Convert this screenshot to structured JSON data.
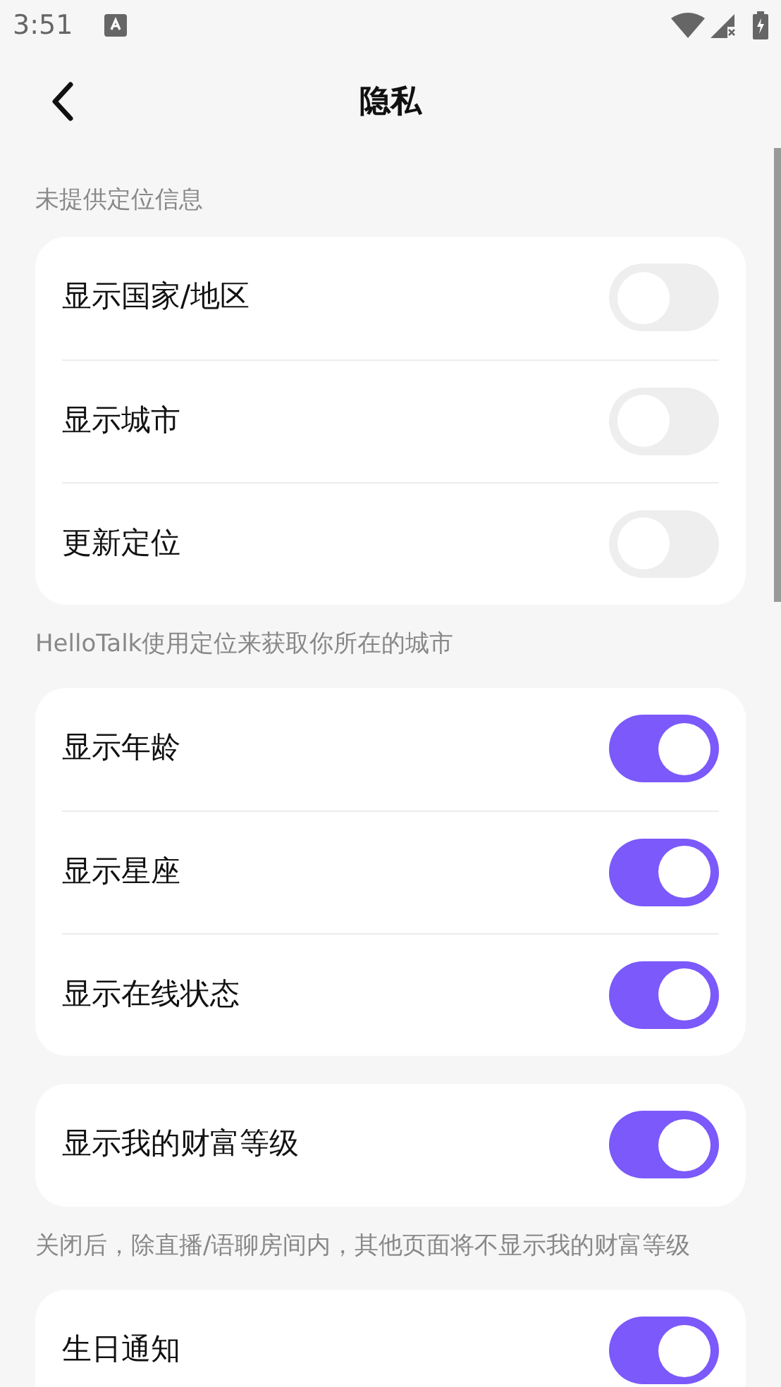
{
  "status_bar": {
    "time": "3:51"
  },
  "header": {
    "title": "隐私"
  },
  "groups": [
    {
      "header": "未提供定位信息",
      "rows": [
        {
          "label": "显示国家/地区",
          "on": false
        },
        {
          "label": "显示城市",
          "on": false
        },
        {
          "label": "更新定位",
          "on": false
        }
      ],
      "footer": "HelloTalk使用定位来获取你所在的城市"
    },
    {
      "rows": [
        {
          "label": "显示年龄",
          "on": true
        },
        {
          "label": "显示星座",
          "on": true
        },
        {
          "label": "显示在线状态",
          "on": true
        }
      ]
    },
    {
      "rows": [
        {
          "label": "显示我的财富等级",
          "on": true
        }
      ],
      "footer": "关闭后，除直播/语聊房间内，其他页面将不显示我的财富等级"
    },
    {
      "rows": [
        {
          "label": "生日通知",
          "on": true
        }
      ]
    }
  ]
}
